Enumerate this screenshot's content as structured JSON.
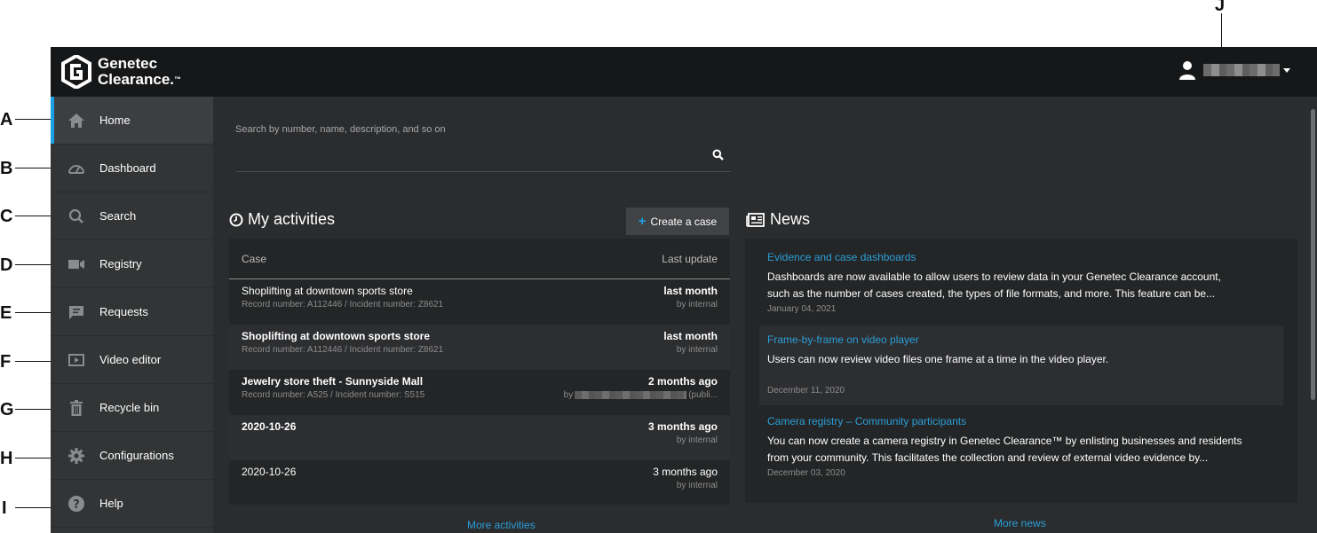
{
  "callouts": [
    "A",
    "B",
    "C",
    "D",
    "E",
    "F",
    "G",
    "H",
    "I",
    "J"
  ],
  "brand": {
    "line1": "Genetec",
    "line2": "Clearance.",
    "tm": "™"
  },
  "sidebar": {
    "items": [
      {
        "label": "Home",
        "icon": "home-icon",
        "active": true
      },
      {
        "label": "Dashboard",
        "icon": "dashboard-gauge-icon"
      },
      {
        "label": "Search",
        "icon": "search-icon"
      },
      {
        "label": "Registry",
        "icon": "camera-icon"
      },
      {
        "label": "Requests",
        "icon": "message-icon"
      },
      {
        "label": "Video editor",
        "icon": "video-editor-icon"
      },
      {
        "label": "Recycle bin",
        "icon": "trash-icon"
      },
      {
        "label": "Configurations",
        "icon": "gear-icon"
      },
      {
        "label": "Help",
        "icon": "help-icon"
      }
    ]
  },
  "search": {
    "placeholder": "Search by number, name, description, and so on"
  },
  "activities": {
    "title": "My activities",
    "create_label": "Create a case",
    "columns": {
      "case": "Case",
      "last_update": "Last update"
    },
    "rows": [
      {
        "title": "Shoplifting at downtown sports store",
        "sub": "Record number: A112446 / Incident number: Z8621",
        "when": "last month",
        "by": "by internal",
        "bold": false
      },
      {
        "title": "Shoplifting at downtown sports store",
        "sub": "Record number: A112446 / Incident number: Z8621",
        "when": "last month",
        "by": "by internal",
        "bold": true
      },
      {
        "title": "Jewelry store theft - Sunnyside Mall",
        "sub": "Record number: A525 / Incident number: S515",
        "when": "2 months ago",
        "by_prefix": "by",
        "by_suffix": "(publi...",
        "bold": true
      },
      {
        "title": "2020-10-26",
        "sub": "",
        "when": "3 months ago",
        "by": "by internal",
        "bold": true
      },
      {
        "title": "2020-10-26",
        "sub": "",
        "when": "3 months ago",
        "by": "by internal",
        "bold": false
      }
    ],
    "more": "More activities"
  },
  "news": {
    "title": "News",
    "items": [
      {
        "title": "Evidence and case dashboards",
        "body1": "Dashboards are now available to allow users to review data in your Genetec Clearance account,",
        "body2": "such as the number of cases created, the types of file formats, and more. This feature can be...",
        "date": "January 04, 2021"
      },
      {
        "title": "Frame-by-frame on video player",
        "body1": "Users can now review video files one frame at a time in the video player.",
        "body2": "",
        "date": "December 11, 2020"
      },
      {
        "title": "Camera registry – Community participants",
        "body1": "You can now create a camera registry in Genetec Clearance™ by enlisting businesses and residents",
        "body2": "from your community. This facilitates the collection and review of external video evidence by...",
        "date": "December 03, 2020"
      }
    ],
    "more": "More news"
  },
  "colors": {
    "accent": "#1aa0e6",
    "link": "#2a9fd8",
    "topbar": "#161718",
    "sidebar": "#333435",
    "main": "#2b2c2e"
  }
}
